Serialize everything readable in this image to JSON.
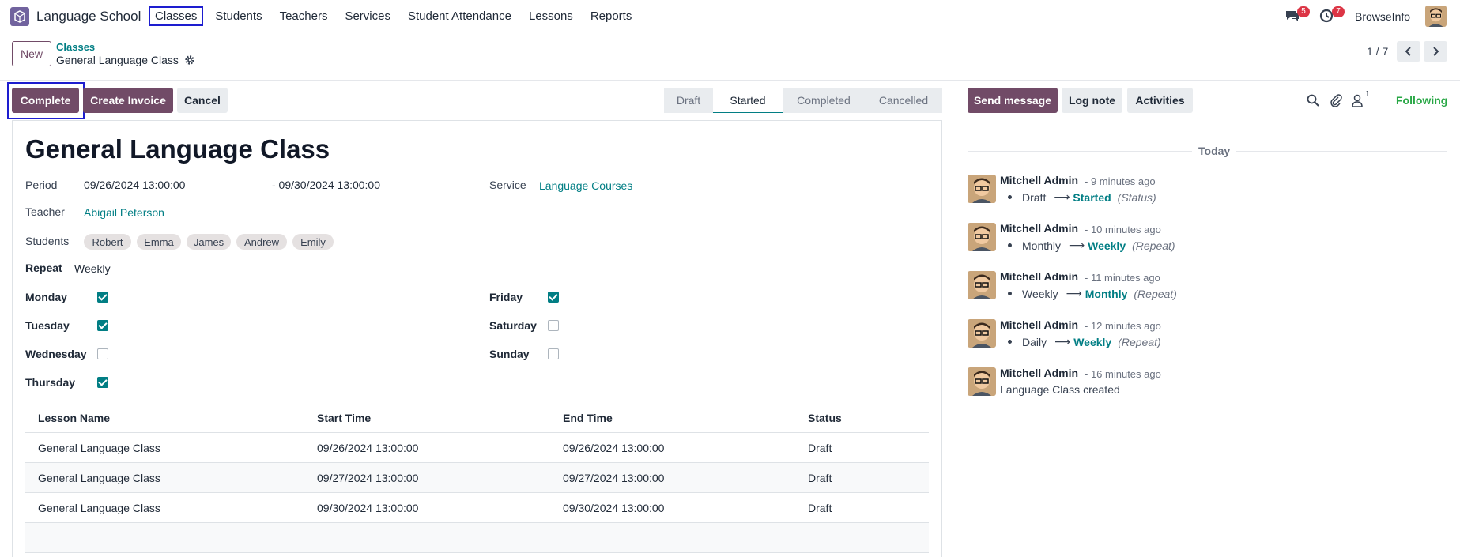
{
  "app": {
    "name": "Language School"
  },
  "menu": [
    "Classes",
    "Students",
    "Teachers",
    "Services",
    "Student Attendance",
    "Lessons",
    "Reports"
  ],
  "systray": {
    "messages_count": "5",
    "activities_count": "7",
    "company": "BrowseInfo"
  },
  "control": {
    "new_label": "New",
    "breadcrumb_parent": "Classes",
    "breadcrumb_current": "General Language Class",
    "pager": "1 / 7"
  },
  "actions": {
    "complete": "Complete",
    "create_invoice": "Create Invoice",
    "cancel": "Cancel"
  },
  "statusbar": [
    "Draft",
    "Started",
    "Completed",
    "Cancelled"
  ],
  "statusbar_current": "Started",
  "form": {
    "title": "General Language Class",
    "period_label": "Period",
    "period_start": "09/26/2024 13:00:00",
    "period_end": "- 09/30/2024 13:00:00",
    "service_label": "Service",
    "service": "Language Courses",
    "teacher_label": "Teacher",
    "teacher": "Abigail Peterson",
    "students_label": "Students",
    "students": [
      "Robert",
      "Emma",
      "James",
      "Andrew",
      "Emily"
    ],
    "repeat_label": "Repeat",
    "repeat": "Weekly",
    "days": [
      {
        "label": "Monday",
        "checked": true
      },
      {
        "label": "Tuesday",
        "checked": true
      },
      {
        "label": "Wednesday",
        "checked": false
      },
      {
        "label": "Thursday",
        "checked": true
      },
      {
        "label": "Friday",
        "checked": true
      },
      {
        "label": "Saturday",
        "checked": false
      },
      {
        "label": "Sunday",
        "checked": false
      }
    ]
  },
  "lessons": {
    "headers": [
      "Lesson Name",
      "Start Time",
      "End Time",
      "Status"
    ],
    "rows": [
      [
        "General Language Class",
        "09/26/2024 13:00:00",
        "09/26/2024 13:00:00",
        "Draft"
      ],
      [
        "General Language Class",
        "09/27/2024 13:00:00",
        "09/27/2024 13:00:00",
        "Draft"
      ],
      [
        "General Language Class",
        "09/30/2024 13:00:00",
        "09/30/2024 13:00:00",
        "Draft"
      ]
    ]
  },
  "chatter": {
    "send_message": "Send message",
    "log_note": "Log note",
    "activities": "Activities",
    "followers_count": "1",
    "following": "Following",
    "today": "Today",
    "messages": [
      {
        "author": "Mitchell Admin",
        "time": "- 9 minutes ago",
        "old": "Draft",
        "new": "Started",
        "field": "(Status)"
      },
      {
        "author": "Mitchell Admin",
        "time": "- 10 minutes ago",
        "old": "Monthly",
        "new": "Weekly",
        "field": "(Repeat)"
      },
      {
        "author": "Mitchell Admin",
        "time": "- 11 minutes ago",
        "old": "Weekly",
        "new": "Monthly",
        "field": "(Repeat)"
      },
      {
        "author": "Mitchell Admin",
        "time": "- 12 minutes ago",
        "old": "Daily",
        "new": "Weekly",
        "field": "(Repeat)"
      },
      {
        "author": "Mitchell Admin",
        "time": "- 16 minutes ago",
        "text": "Language Class created"
      }
    ]
  },
  "colors": {
    "brand": "#714b67",
    "accent": "#017e84",
    "following": "#28a745",
    "badge": "#dc3545",
    "highlight": "#1d1dcf"
  },
  "icons": [
    "app-logo-icon",
    "chat-icon",
    "clock-icon",
    "gear-icon",
    "chevron-left-icon",
    "chevron-right-icon",
    "search-icon",
    "paperclip-icon",
    "user-icon",
    "arrow-right-icon"
  ]
}
